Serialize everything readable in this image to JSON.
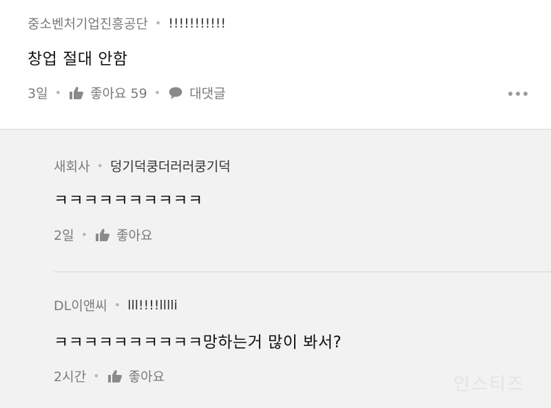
{
  "main_comment": {
    "author": "중소벤처기업진흥공단",
    "separator": "•",
    "nickname": "!!!!!!!!!!!",
    "text": "창업 절대 안함",
    "time": "3일",
    "like_label": "좋아요 59",
    "reply_label": "대댓글",
    "icons": {
      "like": "thumbs-up-icon",
      "reply": "speech-bubble-icon",
      "more": "more-horizontal-icon"
    }
  },
  "replies": [
    {
      "author": "새회사",
      "separator": "•",
      "nickname": "덩기덕쿵더러러쿵기덕",
      "text": "ㅋㅋㅋㅋㅋㅋㅋㅋㅋㅋ",
      "time": "2일",
      "like_label": "좋아요"
    },
    {
      "author": "DL이앤씨",
      "separator": "•",
      "nickname": "lll!!!!lllli",
      "text": "ㅋㅋㅋㅋㅋㅋㅋㅋㅋㅋ망하는거 많이 봐서?",
      "time": "2시간",
      "like_label": "좋아요"
    }
  ],
  "watermark": "인스티즈",
  "colors": {
    "background": "#f2f2f2",
    "card": "#ffffff",
    "meta_text": "#7a7a7a",
    "body_text": "#111111",
    "divider": "#d6d6d6"
  }
}
